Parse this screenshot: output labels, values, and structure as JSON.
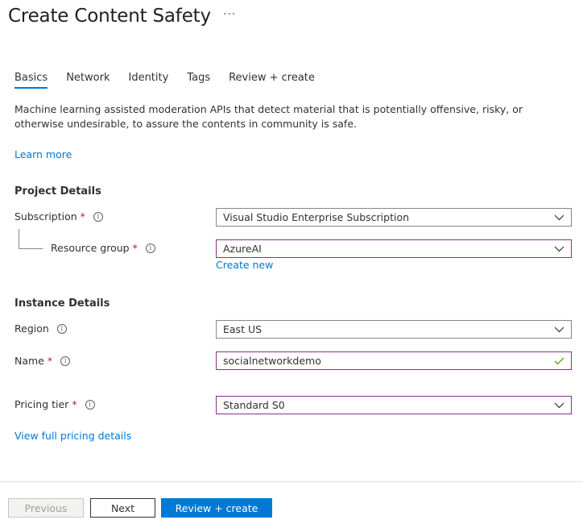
{
  "page": {
    "title": "Create Content Safety",
    "more_label": "···"
  },
  "tabs": [
    {
      "label": "Basics",
      "active": true
    },
    {
      "label": "Network",
      "active": false
    },
    {
      "label": "Identity",
      "active": false
    },
    {
      "label": "Tags",
      "active": false
    },
    {
      "label": "Review + create",
      "active": false
    }
  ],
  "intro": {
    "description": "Machine learning assisted moderation APIs that detect material that is potentially offensive, risky, or otherwise undesirable, to assure the contents in community is safe.",
    "learn_more": "Learn more"
  },
  "project_details": {
    "heading": "Project Details",
    "subscription": {
      "label": "Subscription",
      "required_mark": "*",
      "value": "Visual Studio Enterprise Subscription"
    },
    "resource_group": {
      "label": "Resource group",
      "required_mark": "*",
      "value": "AzureAI",
      "create_new": "Create new"
    }
  },
  "instance_details": {
    "heading": "Instance Details",
    "region": {
      "label": "Region",
      "value": "East US"
    },
    "name": {
      "label": "Name",
      "required_mark": "*",
      "value": "socialnetworkdemo"
    },
    "pricing_tier": {
      "label": "Pricing tier",
      "required_mark": "*",
      "value": "Standard S0"
    },
    "pricing_link": "View full pricing details"
  },
  "footer": {
    "previous_label": "Previous",
    "next_label": "Next",
    "review_label": "Review + create"
  },
  "colors": {
    "accent": "#0078d4",
    "focus_border": "#8b2e8f",
    "required": "#a4262c",
    "valid": "#57a300"
  }
}
